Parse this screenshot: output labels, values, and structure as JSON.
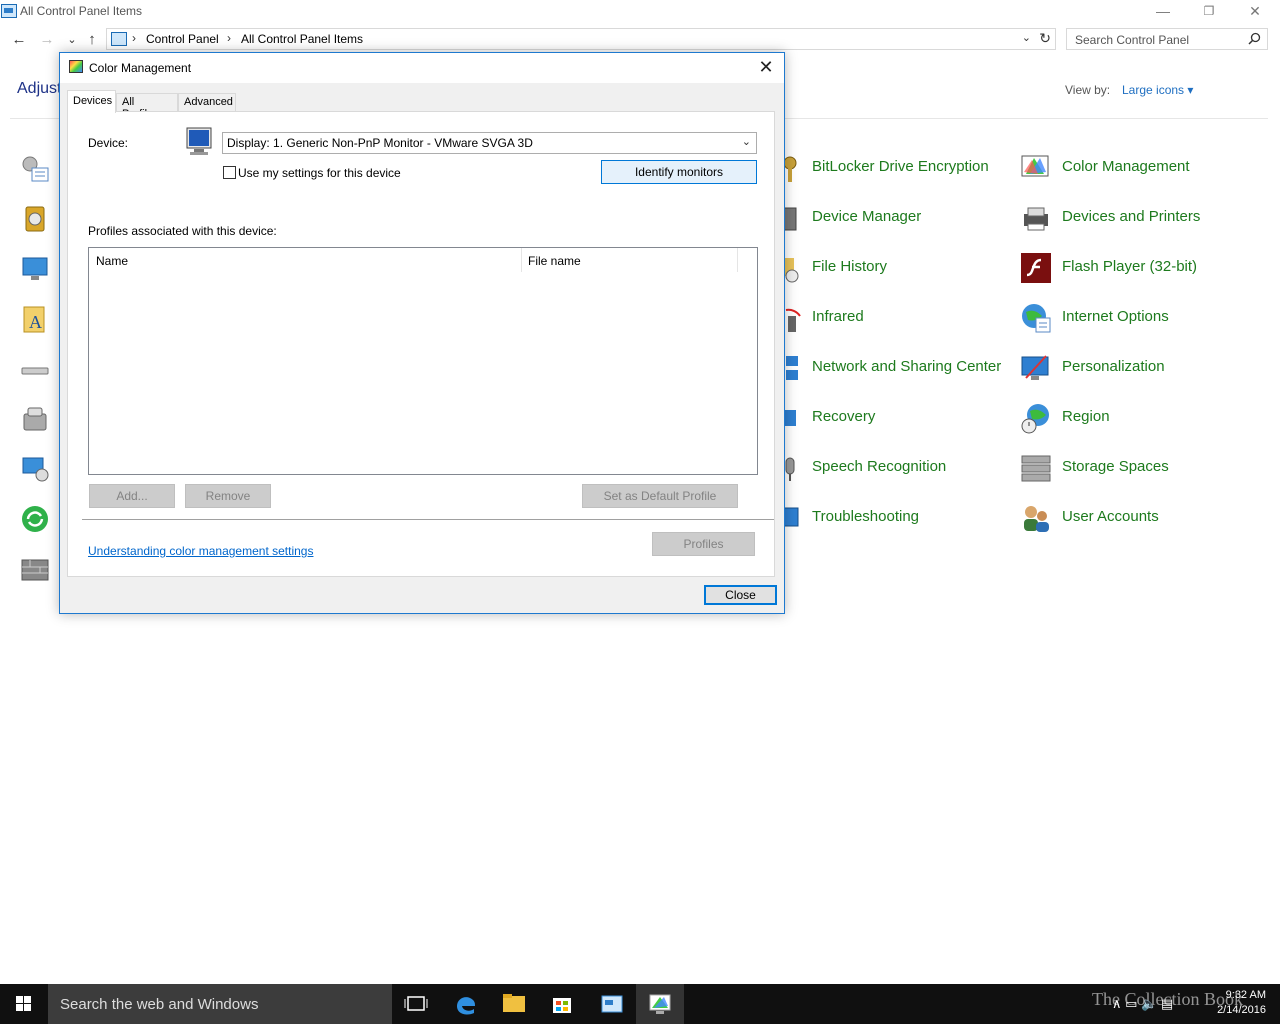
{
  "window": {
    "title": "All Control Panel Items",
    "minimize": "—",
    "restore": "❐",
    "close": "✕"
  },
  "nav": {
    "back": "←",
    "forward": "→",
    "recent": "⌄",
    "up": "↑",
    "breadcrumb": [
      "Control Panel",
      "All Control Panel Items"
    ],
    "separator": "›",
    "dropdown": "⌄",
    "refresh": "↻"
  },
  "search": {
    "placeholder": "Search Control Panel",
    "icon": "search-icon"
  },
  "main": {
    "heading": "Adjust",
    "view_by_label": "View by:",
    "view_by_value": "Large icons ▾"
  },
  "cp_items": [
    {
      "label": "BitLocker Drive Encryption",
      "icon": "bitlocker-icon"
    },
    {
      "label": "Color Management",
      "icon": "color-management-icon"
    },
    {
      "label": "Device Manager",
      "icon": "device-manager-icon"
    },
    {
      "label": "Devices and Printers",
      "icon": "devices-printers-icon"
    },
    {
      "label": "File History",
      "icon": "file-history-icon"
    },
    {
      "label": "Flash Player (32-bit)",
      "icon": "flash-icon"
    },
    {
      "label": "Infrared",
      "icon": "infrared-icon"
    },
    {
      "label": "Internet Options",
      "icon": "internet-options-icon"
    },
    {
      "label": "Network and Sharing Center",
      "icon": "network-icon"
    },
    {
      "label": "Personalization",
      "icon": "personalization-icon"
    },
    {
      "label": "Recovery",
      "icon": "recovery-icon"
    },
    {
      "label": "Region",
      "icon": "region-icon"
    },
    {
      "label": "Speech Recognition",
      "icon": "speech-icon"
    },
    {
      "label": "Storage Spaces",
      "icon": "storage-spaces-icon"
    },
    {
      "label": "Troubleshooting",
      "icon": "troubleshooting-icon"
    },
    {
      "label": "User Accounts",
      "icon": "user-accounts-icon"
    }
  ],
  "dialog": {
    "title": "Color Management",
    "close_glyph": "✕",
    "tabs": [
      "Devices",
      "All Profiles",
      "Advanced"
    ],
    "device_label": "Device:",
    "device_value": "Display: 1. Generic Non-PnP Monitor - VMware SVGA 3D",
    "dropdown_glyph": "⌄",
    "use_my_settings": "Use my settings for this device",
    "use_my_settings_checked": false,
    "identify_monitors": "Identify monitors",
    "profiles_heading": "Profiles associated with this device:",
    "columns": [
      "Name",
      "File name"
    ],
    "rows": [],
    "add": "Add...",
    "remove": "Remove",
    "set_default": "Set as Default Profile",
    "link": "Understanding color management settings",
    "profiles": "Profiles",
    "close": "Close"
  },
  "taskbar": {
    "search_placeholder": "Search the web and Windows",
    "time": "9:32 AM",
    "date": "2/14/2016",
    "tray": "∧  ▭  🔈  ▤",
    "watermark": "The Collection Book"
  },
  "colors": {
    "accent": "#0078d7",
    "link_green": "#1d7a1d",
    "link_blue": "#0066cc",
    "taskbar": "#101010"
  }
}
